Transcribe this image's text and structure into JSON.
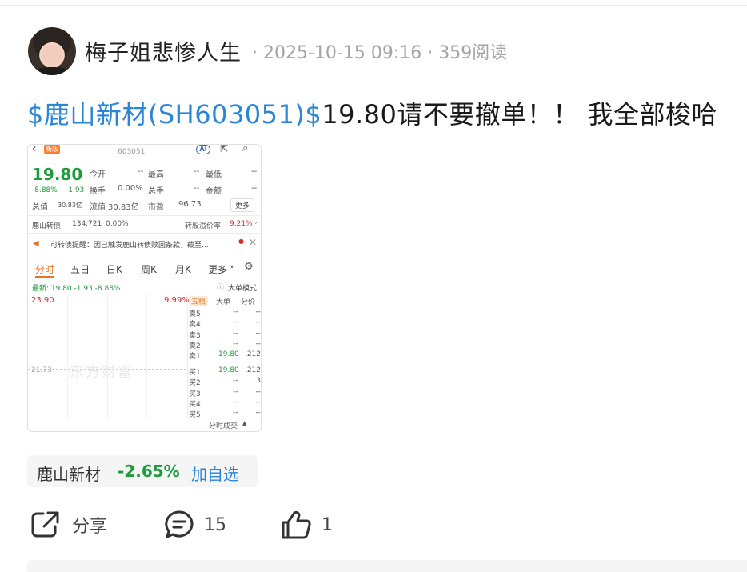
{
  "header": {
    "author": "梅子姐悲惨人生",
    "meta": "· 2025-10-15 09:16 · 359阅读"
  },
  "post": {
    "stock_tag": "$鹿山新材(SH603051)$",
    "text": "19.80请不要撤单！！ 我全部梭哈"
  },
  "quote_screenshot": {
    "code": "603051",
    "ai_label": "AI",
    "new_badge": "新版",
    "price": "19.80",
    "change_pct": "-8.88%",
    "change_amt": "-1.93",
    "fields": {
      "open_label": "今开",
      "open_value": "--",
      "high_label": "最高",
      "high_value": "--",
      "low_label": "最低",
      "low_value": "--",
      "turnover_label": "换手",
      "turnover_value": "0.00%",
      "total_hand_label": "总手",
      "total_hand_value": "--",
      "amount_label": "金额",
      "amount_value": "--",
      "mktcap_label": "总值",
      "mktcap_value": "30.83亿",
      "float_label": "流值",
      "float_value": "30.83亿",
      "pe_label": "市盈",
      "pe_value": "96.73"
    },
    "more_label": "更多",
    "bond_name": "鹿山转债",
    "bond_price": "134.721",
    "bond_pct": "0.00%",
    "premium_label": "转股溢价率",
    "premium_value": "9.21%",
    "notice": "可转债提醒：因已触发鹿山转债赎回条款，截至...",
    "tabs": [
      "分时",
      "五日",
      "日K",
      "周K",
      "月K",
      "更多"
    ],
    "latest_line": "最新: 19.80 -1.93 -8.88%",
    "big_mode": "大单模式",
    "limit_price": "23.90",
    "limit_pct": "9.99%",
    "mid_price": "21.73",
    "watermark": "东方财富",
    "orderbook_tabs": [
      "五档",
      "大单",
      "分价"
    ],
    "asks": [
      {
        "label": "卖5",
        "price": "--",
        "vol": "--"
      },
      {
        "label": "卖4",
        "price": "--",
        "vol": "--"
      },
      {
        "label": "卖3",
        "price": "--",
        "vol": "--"
      },
      {
        "label": "卖2",
        "price": "--",
        "vol": "--"
      },
      {
        "label": "卖1",
        "price": "19.80",
        "vol": "212"
      }
    ],
    "bids": [
      {
        "label": "买1",
        "price": "19.80",
        "vol": "212"
      },
      {
        "label": "买2",
        "price": "--",
        "vol": "3"
      },
      {
        "label": "买3",
        "price": "--",
        "vol": "--"
      },
      {
        "label": "买4",
        "price": "--",
        "vol": "--"
      },
      {
        "label": "买5",
        "price": "--",
        "vol": "--"
      }
    ],
    "ticks_label": "分时成交"
  },
  "stock_chip": {
    "name": "鹿山新材",
    "pct": "-2.65%",
    "add_label": "加自选"
  },
  "actions": {
    "share_label": "分享",
    "comment_count": "15",
    "like_count": "1"
  }
}
